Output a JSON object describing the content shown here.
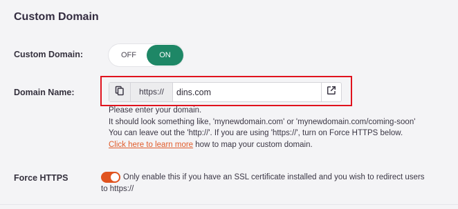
{
  "section": {
    "title": "Custom Domain"
  },
  "custom_domain": {
    "label": "Custom Domain:",
    "off_label": "OFF",
    "on_label": "ON",
    "state": "on"
  },
  "domain_name": {
    "label": "Domain Name:",
    "prefix": "https://",
    "value": "dins.com",
    "copy_icon": "copy-icon",
    "open_icon": "external-link-icon"
  },
  "help": {
    "line1": "Please enter your domain.",
    "line2": "It should look something like, 'mynewdomain.com' or 'mynewdomain.com/coming-soon'",
    "line3": "You can leave out the 'http://'. If you are using 'https://', turn on Force HTTPS below.",
    "link_text": "Click here to learn more",
    "link_suffix": " how to map your custom domain."
  },
  "force_https": {
    "label": "Force HTTPS",
    "enabled": true,
    "description_line1": "Only enable this if you have an SSL certificate installed and you wish to redirect users",
    "description_line2": "to https://"
  },
  "colors": {
    "toggle_on": "#1e8766",
    "switch_on": "#e0531f",
    "link": "#e05b2a",
    "highlight": "#e0121d"
  }
}
